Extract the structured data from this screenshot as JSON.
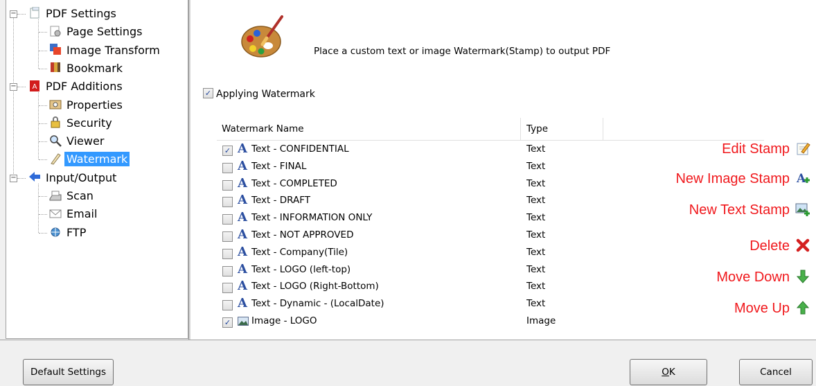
{
  "tree": {
    "items": [
      {
        "label": "PDF Settings",
        "icon": "pdf-settings-icon",
        "level": 0,
        "expander": "−"
      },
      {
        "label": "Page Settings",
        "icon": "page-settings-icon",
        "level": 1
      },
      {
        "label": "Image Transform",
        "icon": "image-transform-icon",
        "level": 1
      },
      {
        "label": "Bookmark",
        "icon": "bookmark-icon",
        "level": 1
      },
      {
        "label": "PDF Additions",
        "icon": "pdf-additions-icon",
        "level": 0,
        "expander": "−"
      },
      {
        "label": "Properties",
        "icon": "properties-icon",
        "level": 1
      },
      {
        "label": "Security",
        "icon": "lock-icon",
        "level": 1
      },
      {
        "label": "Viewer",
        "icon": "viewer-icon",
        "level": 1
      },
      {
        "label": "Watermark",
        "icon": "watermark-icon",
        "level": 1,
        "selected": true
      },
      {
        "label": "Input/Output",
        "icon": "arrow-left-icon",
        "level": 0,
        "expander": "−"
      },
      {
        "label": "Scan",
        "icon": "scanner-icon",
        "level": 1
      },
      {
        "label": "Email",
        "icon": "email-icon",
        "level": 1
      },
      {
        "label": "FTP",
        "icon": "ftp-icon",
        "level": 1
      }
    ]
  },
  "header": {
    "description": "Place a custom text or image Watermark(Stamp) to output PDF"
  },
  "apply_watermark": {
    "label": "Applying Watermark",
    "checked": true
  },
  "list": {
    "columns": [
      "Watermark Name",
      "Type"
    ],
    "rows": [
      {
        "name": "Text - CONFIDENTIAL",
        "type": "Text",
        "checked": true,
        "kind": "text"
      },
      {
        "name": "Text - FINAL",
        "type": "Text",
        "checked": false,
        "kind": "text"
      },
      {
        "name": "Text - COMPLETED",
        "type": "Text",
        "checked": false,
        "kind": "text"
      },
      {
        "name": "Text - DRAFT",
        "type": "Text",
        "checked": false,
        "kind": "text"
      },
      {
        "name": "Text - INFORMATION ONLY",
        "type": "Text",
        "checked": false,
        "kind": "text"
      },
      {
        "name": "Text - NOT APPROVED",
        "type": "Text",
        "checked": false,
        "kind": "text"
      },
      {
        "name": "Text - Company(Tile)",
        "type": "Text",
        "checked": false,
        "kind": "text"
      },
      {
        "name": "Text - LOGO (left-top)",
        "type": "Text",
        "checked": false,
        "kind": "text"
      },
      {
        "name": "Text - LOGO (Right-Bottom)",
        "type": "Text",
        "checked": false,
        "kind": "text"
      },
      {
        "name": "Text - Dynamic - (LocalDate)",
        "type": "Text",
        "checked": false,
        "kind": "text"
      },
      {
        "name": "Image - LOGO",
        "type": "Image",
        "checked": true,
        "kind": "image"
      }
    ]
  },
  "actions": {
    "edit_stamp": "Edit Stamp",
    "new_image_stamp": "New Image Stamp",
    "new_text_stamp": "New Text Stamp",
    "delete": "Delete",
    "move_down": "Move Down",
    "move_up": "Move Up"
  },
  "buttons": {
    "default_settings": "Default Settings",
    "ok_prefix": "",
    "ok_mnemonic": "O",
    "ok_suffix": "K",
    "cancel": "Cancel"
  },
  "colors": {
    "action_text": "#f0181c",
    "selection": "#3399ff"
  }
}
